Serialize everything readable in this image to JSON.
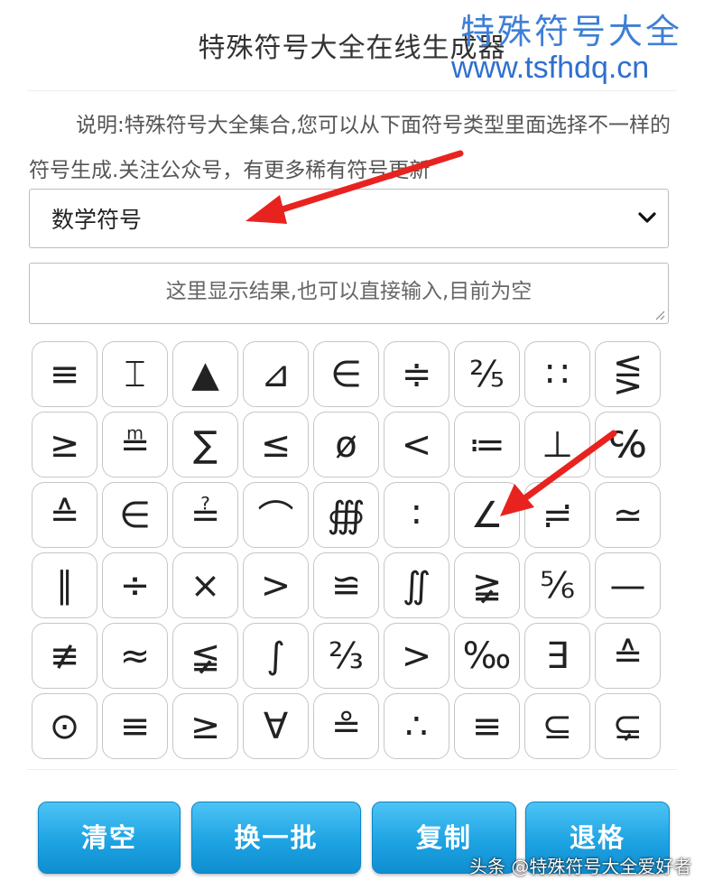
{
  "header": {
    "title": "特殊符号大全在线生成器",
    "watermark_cn": "特殊符号大全",
    "watermark_url": "www.tsfhdq.cn"
  },
  "description": "说明:特殊符号大全集合,您可以从下面符号类型里面选择不一样的符号生成.关注公众号，有更多稀有符号更新",
  "select": {
    "selected": "数学符号"
  },
  "result": {
    "placeholder": "这里显示结果,也可以直接输入,目前为空"
  },
  "symbols": [
    "≡",
    "⌶",
    "▲",
    "⊿",
    "∈",
    "≑",
    "⅖",
    "∷",
    "⋚",
    "≥",
    "≞",
    "∑",
    "≤",
    "ø",
    "<",
    "≔",
    "⊥",
    "℅",
    "≙",
    "∈",
    "≟",
    "⌒",
    "∰",
    "∶",
    "∠",
    "≓",
    "≃",
    "∥",
    "÷",
    "×",
    ">",
    "≌",
    "∬",
    "≩",
    "⅚",
    "—",
    "≢",
    "≈",
    "≨",
    "∫",
    "⅔",
    ">",
    "‰",
    "∃",
    "≙",
    "⊙",
    "≡",
    "≥",
    "∀",
    "≗",
    "∴",
    "≡",
    "⊆",
    "⊊"
  ],
  "buttons": {
    "clear": "清空",
    "shuffle": "换一批",
    "copy": "复制",
    "backspace": "退格"
  },
  "footer": "头条 @特殊符号大全爱好者",
  "colors": {
    "button": "#1ea3e3",
    "watermark": "#3e7fd6",
    "arrow": "#e8231f"
  }
}
